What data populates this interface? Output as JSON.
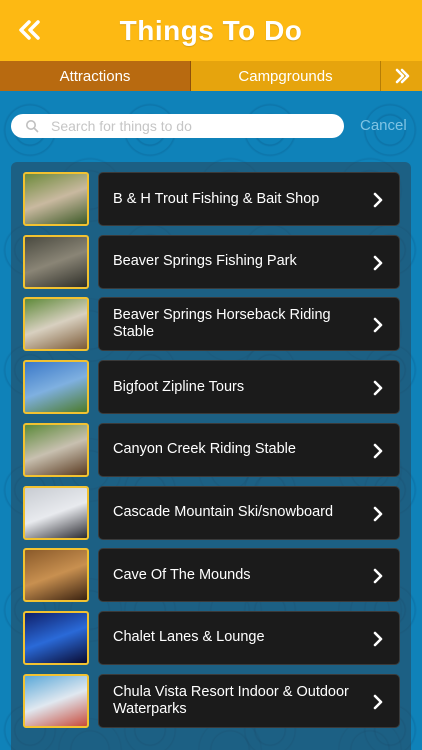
{
  "header": {
    "title": "Things To Do",
    "back_icon": "double-chevron-left-icon",
    "color": "#fdb913"
  },
  "tabs": [
    {
      "label": "Attractions",
      "selected": true
    },
    {
      "label": "Campgrounds",
      "selected": false
    }
  ],
  "tabs_next_icon": "double-chevron-right-icon",
  "search": {
    "placeholder": "Search for things to do",
    "value": "",
    "cancel_label": "Cancel"
  },
  "items": [
    {
      "label": "B & H Trout Fishing & Bait Shop",
      "thumb_colors": [
        "#6d8a3b",
        "#c9b9a0",
        "#3d5a28"
      ]
    },
    {
      "label": "Beaver Springs Fishing Park",
      "thumb_colors": [
        "#4a4a40",
        "#8a8576",
        "#2e2e28"
      ]
    },
    {
      "label": "Beaver Springs Horseback Riding Stable",
      "thumb_colors": [
        "#5f8a3a",
        "#d8d0c0",
        "#7c5a36"
      ]
    },
    {
      "label": "Bigfoot Zipline Tours",
      "thumb_colors": [
        "#3a78c8",
        "#7fb0e0",
        "#4c7a2a"
      ]
    },
    {
      "label": "Canyon Creek Riding Stable",
      "thumb_colors": [
        "#5c8a3a",
        "#c8c0b0",
        "#5a3a20"
      ]
    },
    {
      "label": "Cascade Mountain Ski/snowboard",
      "thumb_colors": [
        "#c8ccd2",
        "#e8eaee",
        "#2a2a30"
      ]
    },
    {
      "label": "Cave Of The Mounds",
      "thumb_colors": [
        "#8a5a2a",
        "#c89050",
        "#3a2210"
      ]
    },
    {
      "label": "Chalet Lanes & Lounge",
      "thumb_colors": [
        "#10206a",
        "#2a6ad8",
        "#0a0a30"
      ]
    },
    {
      "label": "Chula Vista Resort Indoor & Outdoor Waterparks",
      "thumb_colors": [
        "#5aa8d8",
        "#e0e8f0",
        "#c84a3a"
      ]
    }
  ]
}
